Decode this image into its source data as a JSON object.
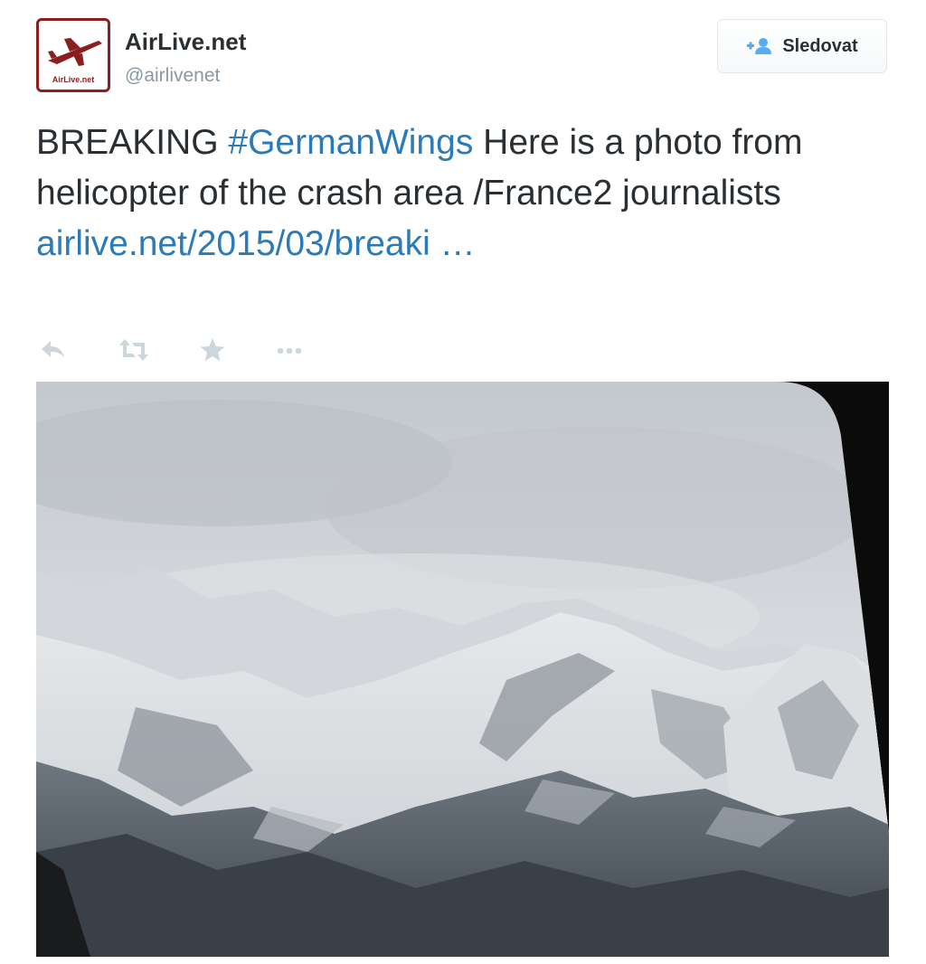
{
  "account": {
    "display_name": "AirLive.net",
    "username": "@airlivenet",
    "avatar_icon": "airlive-logo-icon",
    "avatar_text": "AirLive.net",
    "brand_color": "#8b1e1e"
  },
  "follow_button": {
    "label": "Sledovat",
    "icon": "add-user-icon"
  },
  "tweet": {
    "text_prefix": "BREAKING ",
    "hashtag": "#GermanWings",
    "text_middle": " Here is a photo from helicopter of the crash area /France2 journalists ",
    "link_text": "airlive.net/2015/03/breaki …",
    "link_color": "#2b7bb9"
  },
  "actions": [
    {
      "name": "reply",
      "icon": "reply-icon"
    },
    {
      "name": "retweet",
      "icon": "retweet-icon"
    },
    {
      "name": "favorite",
      "icon": "star-icon"
    },
    {
      "name": "more",
      "icon": "more-icon"
    }
  ],
  "media": {
    "description_icon": "mountain-photo-image"
  }
}
